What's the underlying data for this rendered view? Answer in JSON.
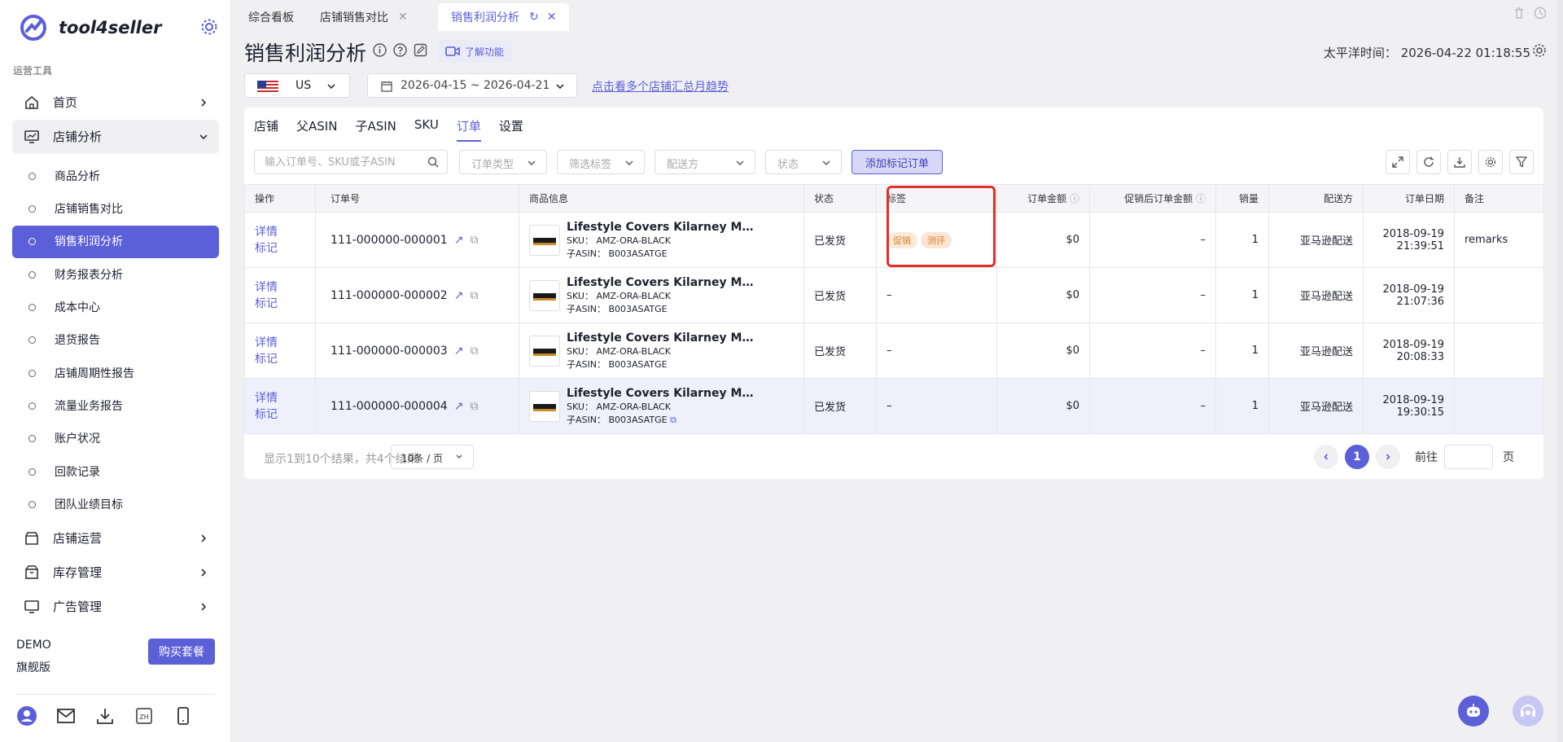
{
  "app": {
    "name": "tool4seller"
  },
  "sidebar": {
    "section_label": "运营工具",
    "nav": [
      {
        "label": "首页"
      },
      {
        "label": "店铺分析"
      },
      {
        "label": "店铺运营"
      },
      {
        "label": "库存管理"
      },
      {
        "label": "广告管理"
      }
    ],
    "sub_items": [
      {
        "label": "商品分析"
      },
      {
        "label": "店铺销售对比"
      },
      {
        "label": "销售利润分析"
      },
      {
        "label": "财务报表分析"
      },
      {
        "label": "成本中心"
      },
      {
        "label": "退货报告"
      },
      {
        "label": "店铺周期性报告"
      },
      {
        "label": "流量业务报告"
      },
      {
        "label": "账户状况"
      },
      {
        "label": "回款记录"
      },
      {
        "label": "团队业绩目标"
      }
    ],
    "plan_name": "DEMO",
    "plan_level": "旗舰版",
    "buy_label": "购买套餐",
    "lang_badge": "ZH"
  },
  "page_tabs": [
    {
      "label": "综合看板"
    },
    {
      "label": "店铺销售对比"
    },
    {
      "label": "销售利润分析"
    }
  ],
  "header": {
    "title": "销售利润分析",
    "learn_label": "了解功能",
    "timezone": "太平洋时间： 2026-04-22 01:18:55"
  },
  "filters_top": {
    "country": "US",
    "date_range": "2026-04-15 ~ 2026-04-21",
    "trend_link": "点击看多个店铺汇总月趋势"
  },
  "subtabs": [
    {
      "label": "店铺"
    },
    {
      "label": "父ASIN"
    },
    {
      "label": "子ASIN"
    },
    {
      "label": "SKU"
    },
    {
      "label": "订单"
    },
    {
      "label": "设置"
    }
  ],
  "filters": {
    "search_placeholder": "输入订单号、SKU或子ASIN",
    "order_type": "订单类型",
    "filter_tag": "筛选标签",
    "fulfillment": "配送方",
    "status": "状态",
    "add_tag_label": "添加标记订单"
  },
  "table": {
    "columns": [
      "操作",
      "订单号",
      "商品信息",
      "状态",
      "标签",
      "订单金额",
      "促销后订单金额",
      "销量",
      "配送方",
      "订单日期",
      "备注"
    ],
    "rows": [
      {
        "op1": "详情",
        "op2": "标记",
        "order_no": "111-000000-000001",
        "title": "Lifestyle Covers Kilarney Mat...",
        "sku": "SKU： AMZ-ORA-BLACK",
        "asin": "子ASIN： B003ASATGE",
        "status": "已发货",
        "tags": [
          "促销",
          "测评"
        ],
        "amount": "$0",
        "promo_amount": "–",
        "qty": "1",
        "fulfillment": "亚马逊配送",
        "date": "2018-09-19",
        "time": "21:39:51",
        "note": "remarks"
      },
      {
        "op1": "详情",
        "op2": "标记",
        "order_no": "111-000000-000002",
        "title": "Lifestyle Covers Kilarney Mat...",
        "sku": "SKU： AMZ-ORA-BLACK",
        "asin": "子ASIN： B003ASATGE",
        "status": "已发货",
        "tag_text": "–",
        "amount": "$0",
        "promo_amount": "–",
        "qty": "1",
        "fulfillment": "亚马逊配送",
        "date": "2018-09-19",
        "time": "21:07:36",
        "note": ""
      },
      {
        "op1": "详情",
        "op2": "标记",
        "order_no": "111-000000-000003",
        "title": "Lifestyle Covers Kilarney Mat...",
        "sku": "SKU： AMZ-ORA-BLACK",
        "asin": "子ASIN： B003ASATGE",
        "status": "已发货",
        "tag_text": "–",
        "amount": "$0",
        "promo_amount": "–",
        "qty": "1",
        "fulfillment": "亚马逊配送",
        "date": "2018-09-19",
        "time": "20:08:33",
        "note": ""
      },
      {
        "op1": "详情",
        "op2": "标记",
        "order_no": "111-000000-000004",
        "title": "Lifestyle Covers Kilarney Mat...",
        "sku": "SKU： AMZ-ORA-BLACK",
        "asin": "子ASIN： B003ASATGE",
        "status": "已发货",
        "tag_text": "–",
        "amount": "$0",
        "promo_amount": "–",
        "qty": "1",
        "fulfillment": "亚马逊配送",
        "date": "2018-09-19",
        "time": "19:30:15",
        "note": ""
      }
    ]
  },
  "pagination": {
    "summary": "显示1到10个结果，共4个结果",
    "page_size": "10条 / 页",
    "current": "1",
    "goto_label": "前往",
    "page_unit": "页"
  },
  "colors": {
    "accent": "#5b5fd8",
    "highlight_box": "#e0302a",
    "tag_orange": "#e07a2a"
  }
}
